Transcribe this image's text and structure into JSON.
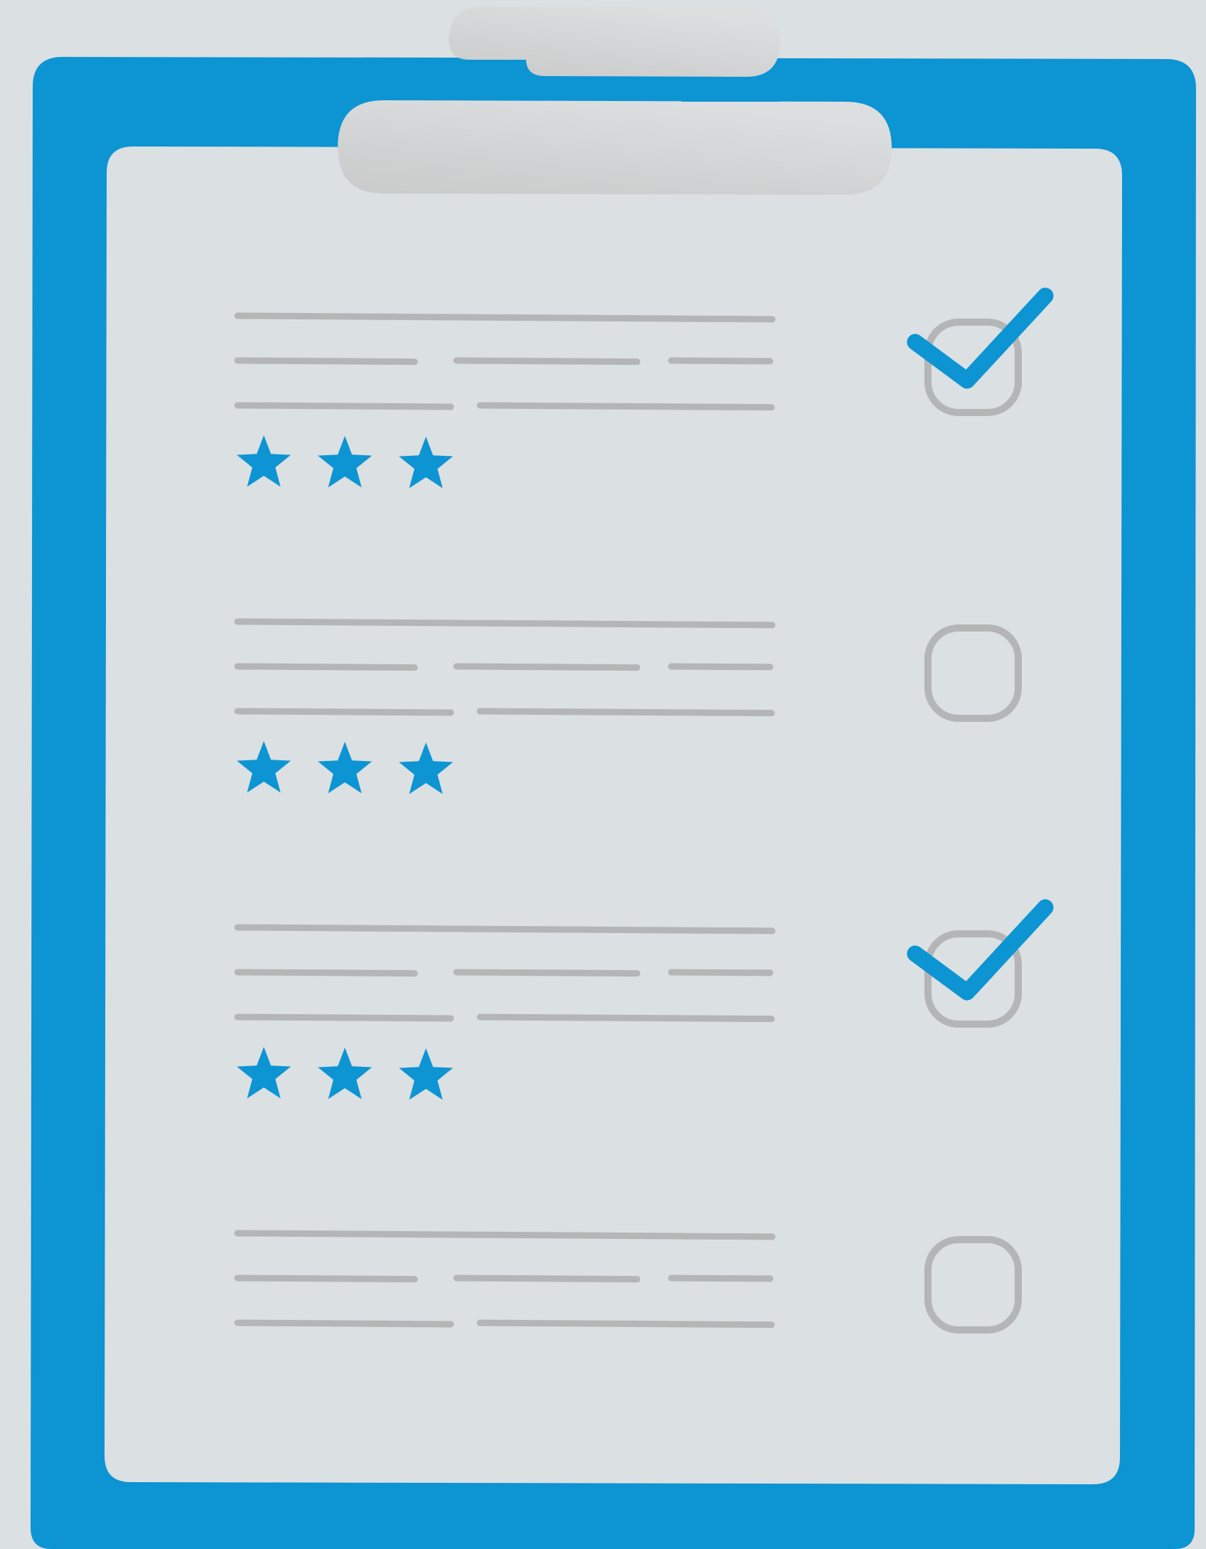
{
  "colors": {
    "background": "#dbe0e2",
    "board": "#0d94d3",
    "paper": "#dbe0e2",
    "clip": "#d0d2d3",
    "text_line": "#b4b5b6",
    "checkbox_border": "#b4b5b6",
    "checkmark": "#0d94d3",
    "star": "#0d94d3"
  },
  "icons": {
    "board": "clipboard-icon",
    "clip": "clipboard-clip-icon",
    "checkbox": "checkbox-icon",
    "check": "checkmark-icon",
    "star": "star-icon"
  },
  "checklist": [
    {
      "checked": true,
      "rating": 3
    },
    {
      "checked": false,
      "rating": 3
    },
    {
      "checked": true,
      "rating": 3
    },
    {
      "checked": false,
      "rating": 0
    }
  ]
}
